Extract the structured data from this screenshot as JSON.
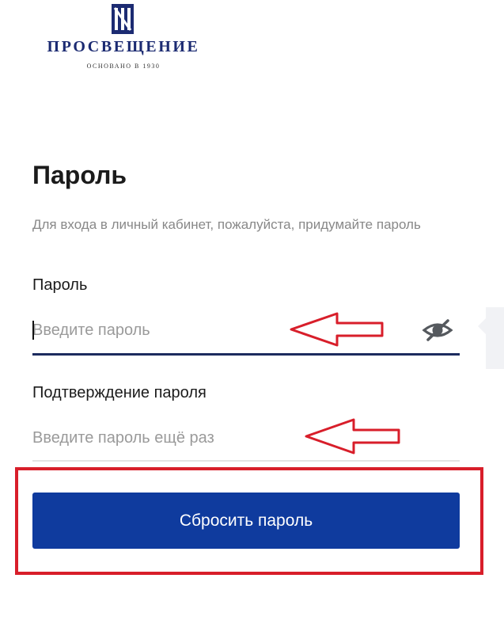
{
  "logo": {
    "name": "ПРОСВЕЩЕНИЕ",
    "tagline": "ОСНОВАНО В 1930",
    "mark_icon": "publisher-logo-mark"
  },
  "page": {
    "title": "Пароль",
    "subtitle": "Для входа в личный кабинет, пожалуйста, придумайте пароль"
  },
  "form": {
    "password": {
      "label": "Пароль",
      "placeholder": "Введите пароль",
      "value": "",
      "toggle_icon": "eye-slash-icon"
    },
    "confirm": {
      "label": "Подтверждение пароля",
      "placeholder": "Введите пароль ещё раз",
      "value": ""
    },
    "submit_label": "Сбросить пароль"
  },
  "annotations": {
    "arrow_color": "#d81e2a",
    "highlight_color": "#d81e2a"
  },
  "colors": {
    "brand": "#1c2b72",
    "button": "#0f3b9e",
    "focus_underline": "#1c2b5e",
    "placeholder": "#9a9a9a"
  }
}
